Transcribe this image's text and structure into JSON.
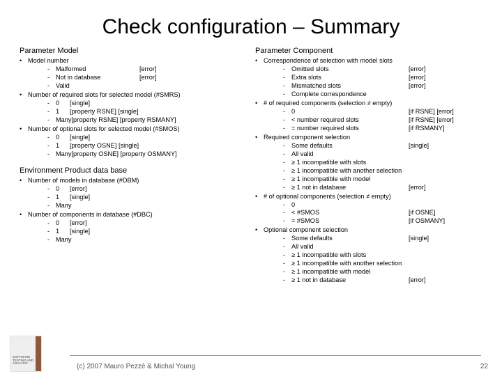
{
  "title": "Check configuration – Summary",
  "left": {
    "section1": {
      "heading": "Parameter Model",
      "item1": {
        "text": "Model number",
        "sub": [
          {
            "label": "Malformed",
            "note": "[error]"
          },
          {
            "label": "Not in database",
            "note": "[error]"
          },
          {
            "label": "Valid",
            "note": ""
          }
        ]
      },
      "item2": {
        "text": "Number of required slots for selected model (#SMRS)",
        "sub": [
          {
            "label": "0",
            "note": "[single]"
          },
          {
            "label": "1",
            "note": "[property RSNE] [single]"
          },
          {
            "label": "Many",
            "note": "[property RSNE] [property RSMANY]"
          }
        ]
      },
      "item3": {
        "text": "Number of optional slots for selected model (#SMOS)",
        "sub": [
          {
            "label": "0",
            "note": "[single]"
          },
          {
            "label": "1",
            "note": " [property OSNE] [single]"
          },
          {
            "label": "Many",
            "note": "[property OSNE] [property OSMANY]"
          }
        ]
      }
    },
    "section2": {
      "heading": "Environment Product data base",
      "item1": {
        "text": "Number of models in database (#DBM)",
        "sub": [
          {
            "label": "0",
            "note": "[error]"
          },
          {
            "label": "1",
            "note": "[single]"
          },
          {
            "label": "Many",
            "note": ""
          }
        ]
      },
      "item2": {
        "text": "Number of components in database (#DBC)",
        "sub": [
          {
            "label": "0",
            "note": "[error]"
          },
          {
            "label": "1",
            "note": "[single]"
          },
          {
            "label": "Many",
            "note": ""
          }
        ]
      }
    }
  },
  "right": {
    "heading": "Parameter Component",
    "item1": {
      "text": "Correspondence of selection with model slots",
      "sub": [
        {
          "label": "Omitted slots",
          "note": "[error]"
        },
        {
          "label": "Extra slots",
          "note": "[error]"
        },
        {
          "label": "Mismatched slots",
          "note": "[error]"
        },
        {
          "label": "Complete correspondence",
          "note": ""
        }
      ]
    },
    "item2": {
      "text": "# of required components (selection ≠ empty)",
      "sub": [
        {
          "label": "0",
          "note": "[if RSNE] [error]"
        },
        {
          "label": "< number required slots",
          "note": "[if RSNE] [error]"
        },
        {
          "label": "= number required slots",
          "note": "[if RSMANY]"
        }
      ]
    },
    "item3": {
      "text": "Required component selection",
      "sub": [
        {
          "label": "Some defaults",
          "note": "[single]"
        },
        {
          "label": "All valid",
          "note": ""
        },
        {
          "label": "≥ 1 incompatible with slots",
          "note": ""
        },
        {
          "label": "≥ 1 incompatible with another selection",
          "note": ""
        },
        {
          "label": "≥ 1 incompatible with model",
          "note": ""
        },
        {
          "label": "≥ 1 not in database",
          "note": "[error]"
        }
      ]
    },
    "item4": {
      "text": "# of optional components (selection ≠ empty)",
      "sub": [
        {
          "label": "0",
          "note": ""
        },
        {
          "label": "< #SMOS",
          "note": "[if OSNE]"
        },
        {
          "label": "= #SMOS",
          "note": "[if OSMANY]"
        }
      ]
    },
    "item5": {
      "text": "Optional component selection",
      "sub": [
        {
          "label": "Some defaults",
          "note": "[single]"
        },
        {
          "label": "All valid",
          "note": ""
        },
        {
          "label": "≥ 1 incompatible with slots",
          "note": ""
        },
        {
          "label": "≥ 1 incompatible with another selection",
          "note": ""
        },
        {
          "label": "≥ 1 incompatible with model",
          "note": ""
        },
        {
          "label": "≥ 1 not in database",
          "note": "[error]"
        }
      ]
    }
  },
  "logo_text": "SOFTWARE TESTING\nAND ANALYSIS",
  "footer": {
    "copyright": "(c) 2007 Mauro Pezzè & Michal Young",
    "page": "22"
  }
}
